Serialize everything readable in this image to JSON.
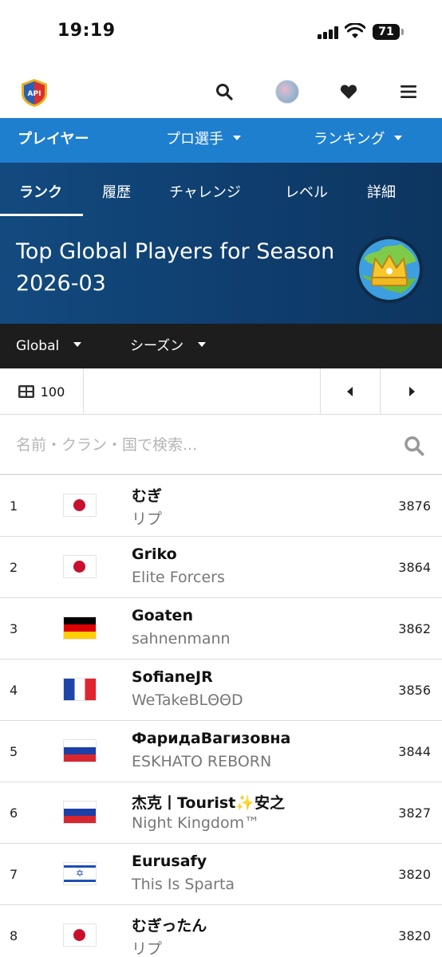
{
  "status_bar": {
    "time": "19:19",
    "battery": "71"
  },
  "header": {
    "logo_text": "API"
  },
  "main_nav": [
    {
      "label": "プレイヤー",
      "has_dropdown": false
    },
    {
      "label": "プロ選手",
      "has_dropdown": true
    },
    {
      "label": "ランキング",
      "has_dropdown": true
    }
  ],
  "tabs": [
    {
      "label": "ランク",
      "active": true
    },
    {
      "label": "履歴",
      "active": false
    },
    {
      "label": "チャレンジ",
      "active": false
    },
    {
      "label": "レベル",
      "active": false
    },
    {
      "label": "詳細",
      "active": false
    }
  ],
  "hero": {
    "title": "Top Global Players for Season 2026-03"
  },
  "filters": {
    "region": "Global",
    "season": "シーズン"
  },
  "pager": {
    "page_size": "100"
  },
  "search": {
    "placeholder": "名前・クラン・国で検索..."
  },
  "players": [
    {
      "rank": "1",
      "flag": "jp",
      "name": "むぎ",
      "clan": "リプ",
      "trophies": "3876"
    },
    {
      "rank": "2",
      "flag": "jp",
      "name": "Griko",
      "clan": "Elite Forcers",
      "trophies": "3864"
    },
    {
      "rank": "3",
      "flag": "de",
      "name": "Goaten",
      "clan": "sahnenmann",
      "trophies": "3862"
    },
    {
      "rank": "4",
      "flag": "fr",
      "name": "SofianeJR",
      "clan": "WeTakeBLΘΘD",
      "trophies": "3856"
    },
    {
      "rank": "5",
      "flag": "ru",
      "name": "ФаридаВагизовна",
      "clan": "ESKHATO REBORN",
      "trophies": "3844"
    },
    {
      "rank": "6",
      "flag": "ru",
      "name": "杰克丨Tourist✨安之",
      "clan": "Night Kingdom™",
      "trophies": "3827"
    },
    {
      "rank": "7",
      "flag": "il",
      "name": "Eurusafy",
      "clan": "This Is Sparta",
      "trophies": "3820"
    },
    {
      "rank": "8",
      "flag": "jp",
      "name": "むぎったん",
      "clan": "リプ",
      "trophies": "3820"
    }
  ],
  "colors": {
    "nav_blue": "#1f7fcf",
    "hero_blue": "#124a7f",
    "filter_dark": "#1d1d1d"
  }
}
